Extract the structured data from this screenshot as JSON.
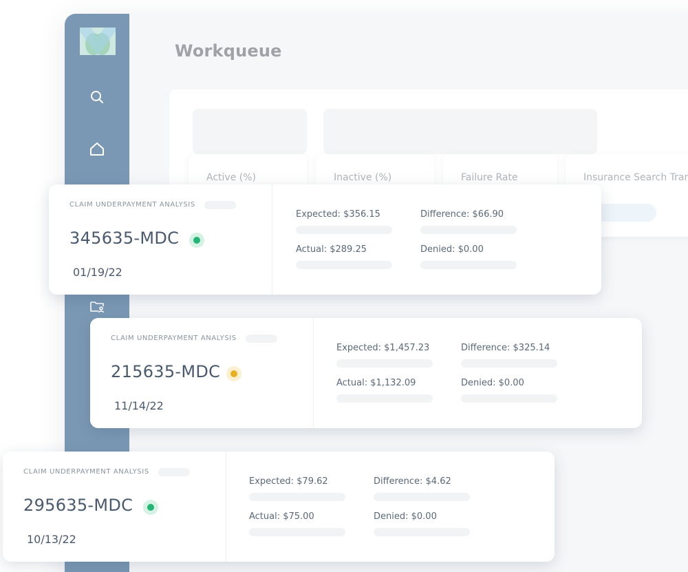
{
  "page": {
    "title": "Workqueue"
  },
  "sidebar": {
    "items": [
      {
        "icon": "search-icon"
      },
      {
        "icon": "home-icon"
      },
      {
        "icon": "folder-user-icon"
      }
    ],
    "color": "#7a98b4"
  },
  "stats": [
    {
      "label": "Active (%)"
    },
    {
      "label": "Inactive (%)"
    },
    {
      "label": "Failure Rate"
    },
    {
      "label": "Insurance Search Tran"
    }
  ],
  "claims": [
    {
      "type_label": "CLAIM UNDERPAYMENT ANALYSIS",
      "claim_id": "345635-MDC",
      "status": "green",
      "status_color": "#22b573",
      "date": "01/19/22",
      "expected": "Expected: $356.15",
      "actual": "Actual: $289.25",
      "difference": "Difference: $66.90",
      "denied": "Denied: $0.00"
    },
    {
      "type_label": "CLAIM UNDERPAYMENT ANALYSIS",
      "claim_id": "215635-MDC",
      "status": "yellow",
      "status_color": "#e6b020",
      "date": "11/14/22",
      "expected": "Expected: $1,457.23",
      "actual": "Actual: $1,132.09",
      "difference": "Difference: $325.14",
      "denied": "Denied: $0.00"
    },
    {
      "type_label": "CLAIM UNDERPAYMENT ANALYSIS",
      "claim_id": "295635-MDC",
      "status": "green",
      "status_color": "#22b573",
      "date": "10/13/22",
      "expected": "Expected: $79.62",
      "actual": "Actual: $75.00",
      "difference": "Difference: $4.62",
      "denied": "Denied: $0.00"
    }
  ]
}
